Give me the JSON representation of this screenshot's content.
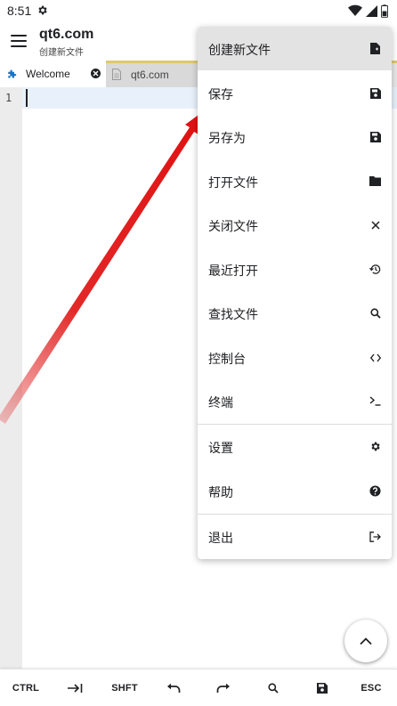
{
  "status_bar": {
    "time": "8:51",
    "icons": [
      "settings-icon",
      "wifi-icon",
      "signal-icon",
      "battery-icon"
    ]
  },
  "app_bar": {
    "title": "qt6.com",
    "subtitle": "创建新文件"
  },
  "tabs": [
    {
      "label": "Welcome",
      "icon": "extension-icon",
      "active": true,
      "closable": true
    },
    {
      "label": "qt6.com",
      "icon": "file-icon",
      "active": false
    }
  ],
  "editor": {
    "line_numbers": [
      "1"
    ]
  },
  "menu": {
    "items": [
      {
        "label": "创建新文件",
        "icon": "new-file-icon",
        "highlighted": true
      },
      {
        "label": "保存",
        "icon": "save-icon"
      },
      {
        "label": "另存为",
        "icon": "save-as-icon"
      },
      {
        "label": "打开文件",
        "icon": "folder-icon"
      },
      {
        "label": "关闭文件",
        "icon": "close-icon"
      },
      {
        "label": "最近打开",
        "icon": "history-icon"
      },
      {
        "label": "查找文件",
        "icon": "search-icon"
      },
      {
        "label": "控制台",
        "icon": "code-icon"
      },
      {
        "label": "终端",
        "icon": "terminal-icon"
      },
      {
        "label": "设置",
        "icon": "gear-icon"
      },
      {
        "label": "帮助",
        "icon": "help-icon"
      },
      {
        "label": "退出",
        "icon": "exit-icon"
      }
    ]
  },
  "toolbar": {
    "ctrl_label": "CTRL",
    "shift_label": "SHFT",
    "esc_label": "ESC",
    "icons": [
      "tab-icon",
      "undo-icon",
      "redo-icon",
      "search-icon",
      "save-icon"
    ]
  },
  "fab": {
    "icon": "chevron-up-icon"
  },
  "colors": {
    "tab_accent": "#e0c96a",
    "active_line": "#e8f1fb",
    "menu_highlight": "#e3e3e3",
    "annotation_arrow": "#e01010"
  }
}
